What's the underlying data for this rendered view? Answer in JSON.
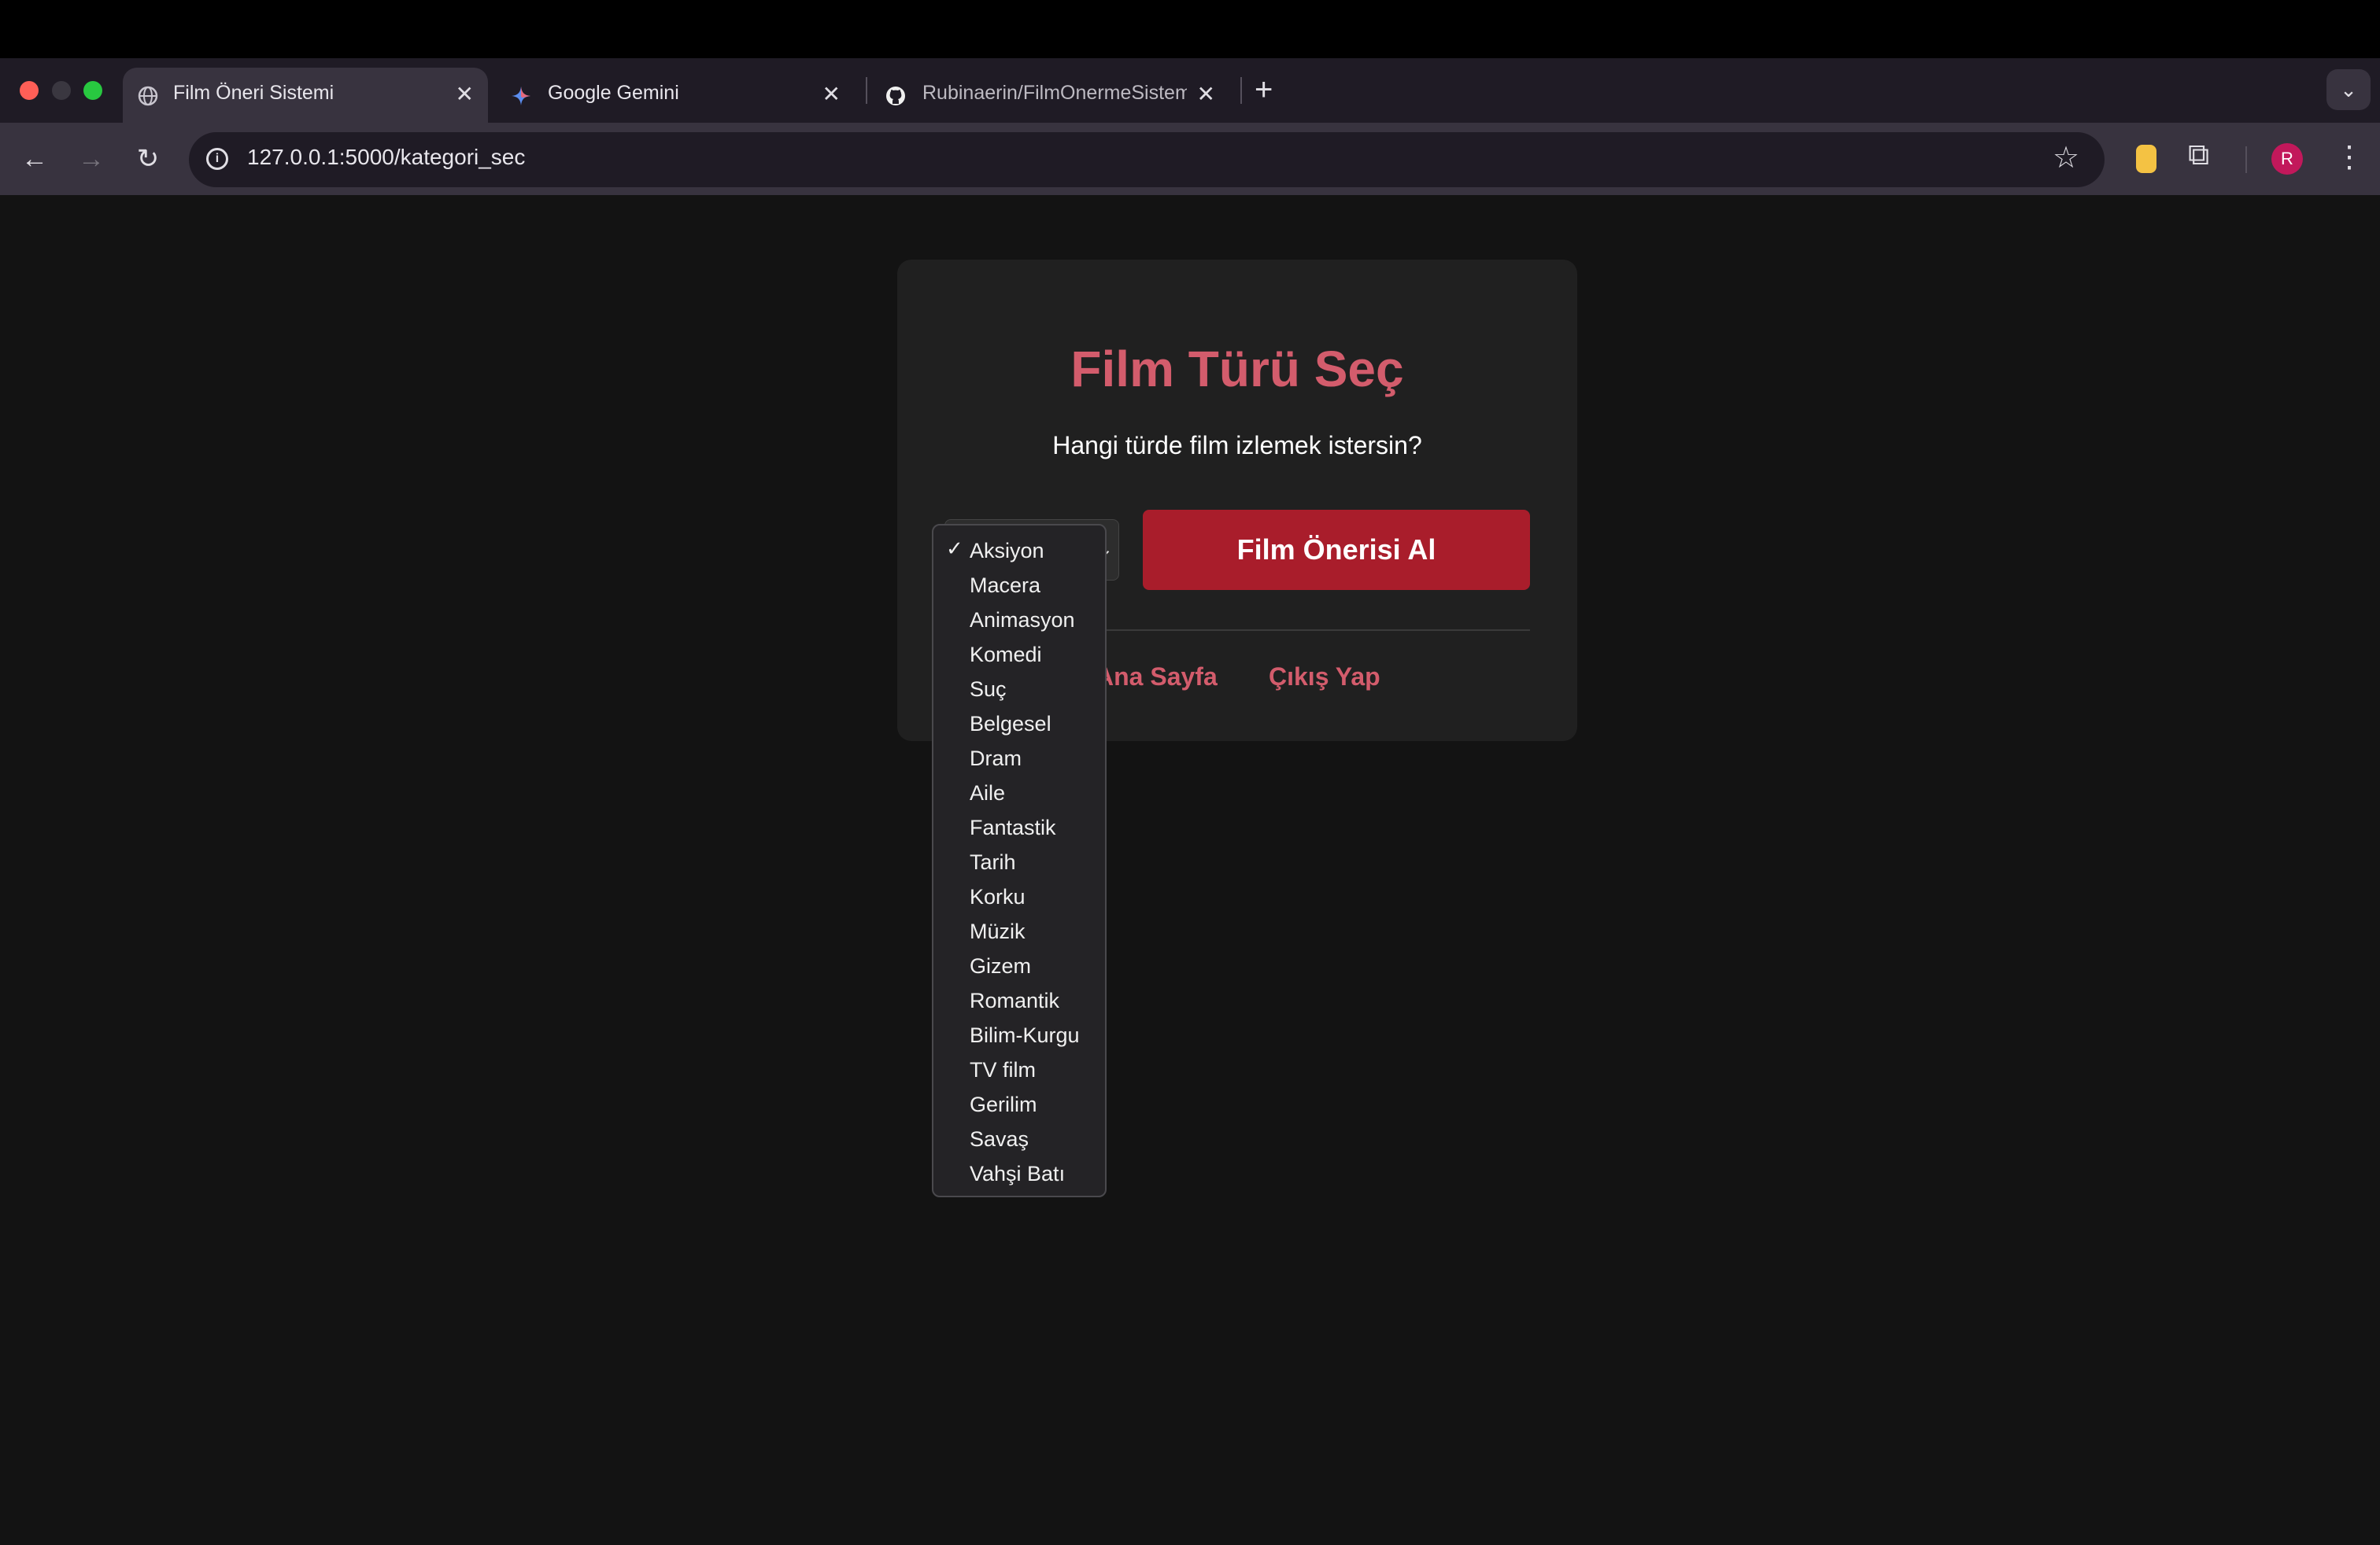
{
  "browser": {
    "tabs": [
      {
        "title": "Film Öneri Sistemi",
        "icon": "globe-icon",
        "active": true
      },
      {
        "title": "Google Gemini",
        "icon": "gemini-icon",
        "active": false
      },
      {
        "title": "Rubinaerin/FilmOnermeSistem",
        "icon": "github-icon",
        "active": false
      }
    ],
    "close_glyph": "✕",
    "new_tab_glyph": "+",
    "url": "127.0.0.1:5000/kategori_sec",
    "profile_initial": "R",
    "colors": {
      "tabstrip": "#1f1b25",
      "toolbar": "#38333f"
    }
  },
  "page": {
    "title": "Film Türü Seç",
    "subtitle": "Hangi türde film izlemek istersin?",
    "submit_label": "Film Önerisi Al",
    "links": {
      "home": "Ana Sayfa",
      "logout": "Çıkış Yap"
    },
    "genre_select": {
      "selected": "Aksiyon",
      "options": [
        "Aksiyon",
        "Macera",
        "Animasyon",
        "Komedi",
        "Suç",
        "Belgesel",
        "Dram",
        "Aile",
        "Fantastik",
        "Tarih",
        "Korku",
        "Müzik",
        "Gizem",
        "Romantik",
        "Bilim-Kurgu",
        "TV film",
        "Gerilim",
        "Savaş",
        "Vahşi Batı"
      ]
    },
    "colors": {
      "accent": "#d35c6c",
      "button": "#a91d2b",
      "card": "#202020",
      "background": "#131313"
    }
  }
}
